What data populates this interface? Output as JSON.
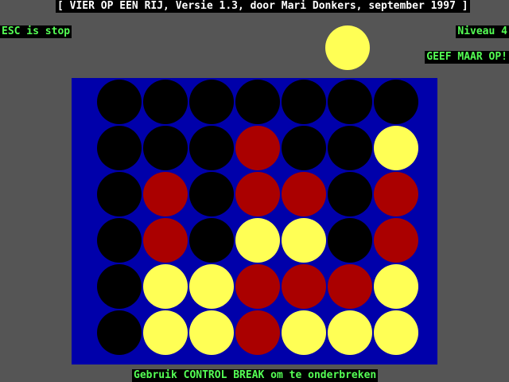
{
  "header": {
    "title": "[ VIER OP EEN RIJ, Versie 1.3, door Mari Donkers, september 1997 ]"
  },
  "controls": {
    "esc_hint": "ESC is stop",
    "level": "Niveau 4",
    "give_up": "GEEF MAAR OP!"
  },
  "footer": {
    "hint": "Gebruik CONTROL BREAK om te onderbreken"
  },
  "colors": {
    "background": "#555555",
    "board": "#0000aa",
    "empty": "#000000",
    "red": "#aa0000",
    "yellow": "#ffff55",
    "label_green": "#55ff55",
    "title_white": "#ffffff"
  },
  "hover_piece": {
    "color": "yellow",
    "column": 6
  },
  "board": {
    "rows": 6,
    "columns": 7,
    "cells": [
      [
        "empty",
        "empty",
        "empty",
        "empty",
        "empty",
        "empty",
        "empty"
      ],
      [
        "empty",
        "empty",
        "empty",
        "red",
        "empty",
        "empty",
        "yellow"
      ],
      [
        "empty",
        "red",
        "empty",
        "red",
        "red",
        "empty",
        "red"
      ],
      [
        "empty",
        "red",
        "empty",
        "yellow",
        "yellow",
        "empty",
        "red"
      ],
      [
        "empty",
        "yellow",
        "yellow",
        "red",
        "red",
        "red",
        "yellow"
      ],
      [
        "empty",
        "yellow",
        "yellow",
        "red",
        "yellow",
        "yellow",
        "yellow"
      ]
    ]
  }
}
